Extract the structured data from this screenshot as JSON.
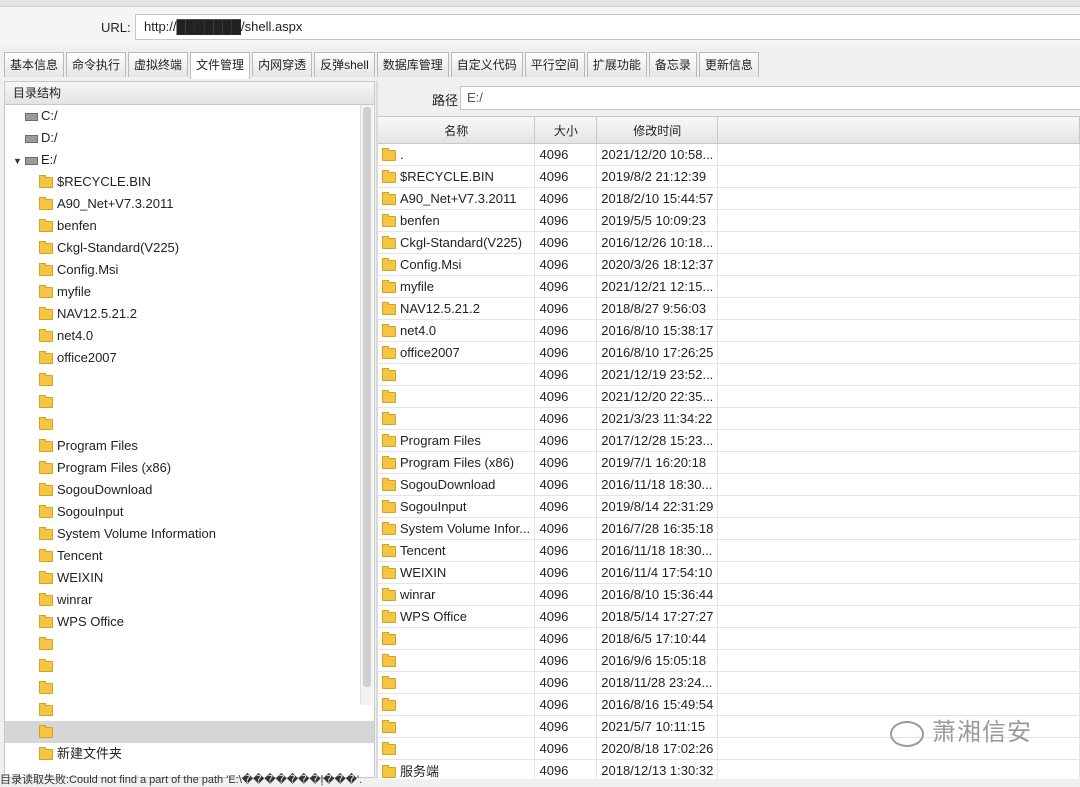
{
  "address": {
    "label": "URL:",
    "value": "http://███████/shell.aspx"
  },
  "tabs": [
    "基本信息",
    "命令执行",
    "虚拟终端",
    "文件管理",
    "内网穿透",
    "反弹shell",
    "数据库管理",
    "自定义代码",
    "平行空间",
    "扩展功能",
    "备忘录",
    "更新信息"
  ],
  "active_tab": "文件管理",
  "tree": {
    "header": "目录结构",
    "drives": [
      "C:/",
      "D:/",
      "E:/"
    ],
    "folders": [
      "$RECYCLE.BIN",
      "A90_Net+V7.3.2011",
      "benfen",
      "Ckgl-Standard(V225)",
      "Config.Msi",
      "myfile",
      "NAV12.5.21.2",
      "net4.0",
      "office2007",
      "",
      "",
      "",
      "Program Files",
      "Program Files (x86)",
      "SogouDownload",
      "SogouInput",
      "System Volume Information",
      "Tencent",
      "WEIXIN",
      "winrar",
      "WPS Office",
      "",
      "",
      "",
      "",
      "",
      "新建文件夹"
    ]
  },
  "path": {
    "label": "路径",
    "value": "E:/"
  },
  "table": {
    "headers": [
      "名称",
      "大小",
      "修改时间"
    ],
    "rows": [
      [
        ".",
        "4096",
        "2021/12/20 10:58..."
      ],
      [
        "$RECYCLE.BIN",
        "4096",
        "2019/8/2 21:12:39"
      ],
      [
        "A90_Net+V7.3.2011",
        "4096",
        "2018/2/10 15:44:57"
      ],
      [
        "benfen",
        "4096",
        "2019/5/5 10:09:23"
      ],
      [
        "Ckgl-Standard(V225)",
        "4096",
        "2016/12/26 10:18..."
      ],
      [
        "Config.Msi",
        "4096",
        "2020/3/26 18:12:37"
      ],
      [
        "myfile",
        "4096",
        "2021/12/21 12:15..."
      ],
      [
        "NAV12.5.21.2",
        "4096",
        "2018/8/27 9:56:03"
      ],
      [
        "net4.0",
        "4096",
        "2016/8/10 15:38:17"
      ],
      [
        "office2007",
        "4096",
        "2016/8/10 17:26:25"
      ],
      [
        "",
        "4096",
        "2021/12/19 23:52..."
      ],
      [
        "",
        "4096",
        "2021/12/20 22:35..."
      ],
      [
        "",
        "4096",
        "2021/3/23 11:34:22"
      ],
      [
        "Program Files",
        "4096",
        "2017/12/28 15:23..."
      ],
      [
        "Program Files (x86)",
        "4096",
        "2019/7/1 16:20:18"
      ],
      [
        "SogouDownload",
        "4096",
        "2016/11/18 18:30..."
      ],
      [
        "SogouInput",
        "4096",
        "2019/8/14 22:31:29"
      ],
      [
        "System Volume Infor...",
        "4096",
        "2016/7/28 16:35:18"
      ],
      [
        "Tencent",
        "4096",
        "2016/11/18 18:30..."
      ],
      [
        "WEIXIN",
        "4096",
        "2016/11/4 17:54:10"
      ],
      [
        "winrar",
        "4096",
        "2016/8/10 15:36:44"
      ],
      [
        "WPS Office",
        "4096",
        "2018/5/14 17:27:27"
      ],
      [
        "",
        "4096",
        "2018/6/5 17:10:44"
      ],
      [
        "",
        "4096",
        "2016/9/6 15:05:18"
      ],
      [
        "",
        "4096",
        "2018/11/28 23:24..."
      ],
      [
        "",
        "4096",
        "2016/8/16 15:49:54"
      ],
      [
        "",
        "4096",
        "2021/5/7 10:11:15"
      ],
      [
        "",
        "4096",
        "2020/8/18 17:02:26"
      ],
      [
        "服务端",
        "4096",
        "2018/12/13 1:30:32"
      ]
    ]
  },
  "status": "目录读取失败:Could not find a part of the path 'E:\\�������ļ���'.",
  "watermark": "萧湘信安",
  "icons": {
    "drive": "drive-icon",
    "folder": "folder-icon",
    "expand": "triangle-down-icon"
  }
}
